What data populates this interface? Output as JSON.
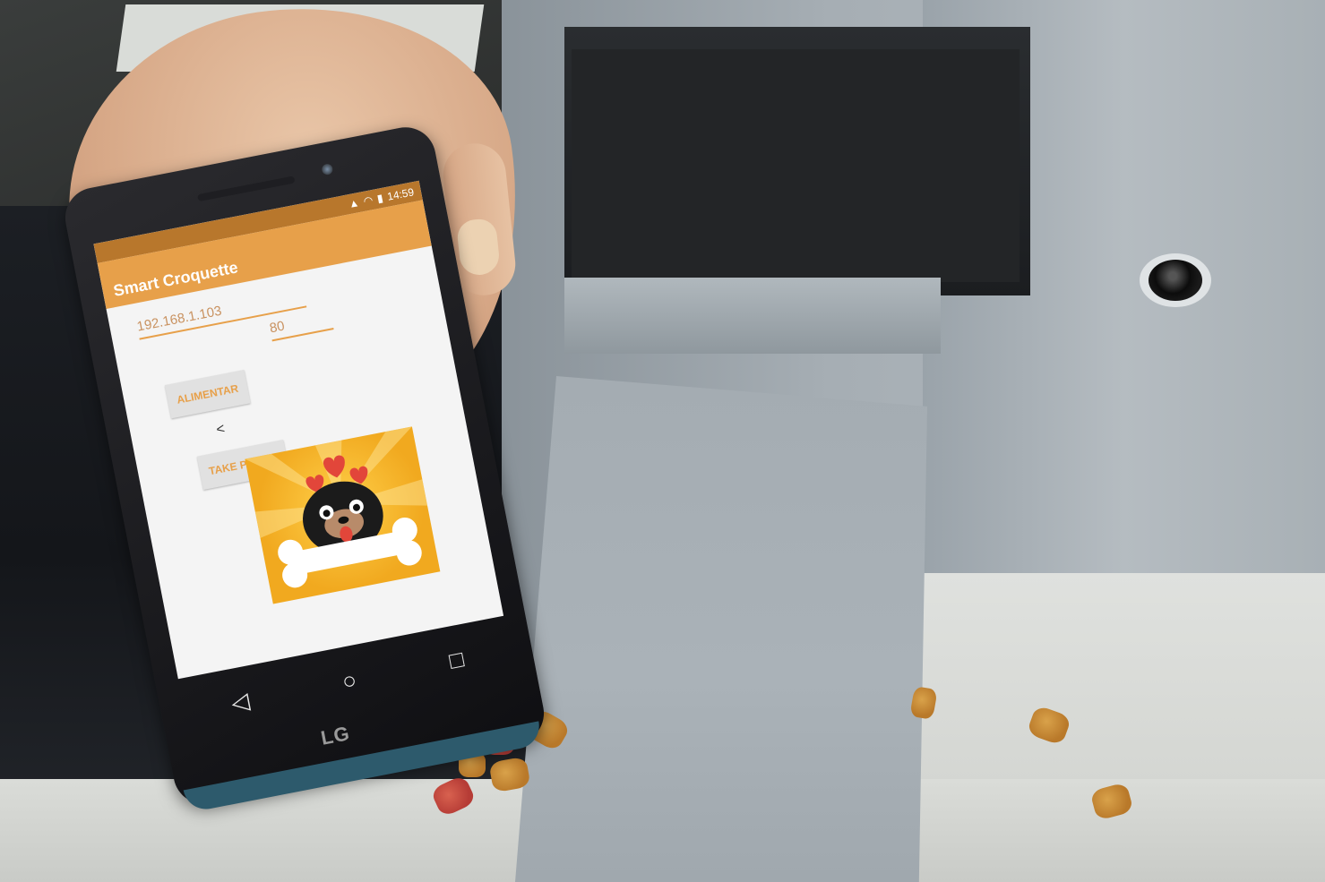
{
  "status_bar": {
    "time": "14:59"
  },
  "app": {
    "title": "Smart Croquette",
    "ip_field": {
      "value": "192.168.1.103"
    },
    "port_field": {
      "value": "80"
    },
    "feed_button": {
      "label": "ALIMENTAR"
    },
    "back_label": "<",
    "photo_button": {
      "label": "TAKE PHOTO"
    },
    "image": {
      "icon": "pug-with-bone-icon"
    }
  },
  "phone": {
    "brand": "LG"
  },
  "nav": {
    "back": "◁",
    "home": "○",
    "recent": "□"
  },
  "colors": {
    "accent": "#e7a04a",
    "status": "#b8772c"
  }
}
